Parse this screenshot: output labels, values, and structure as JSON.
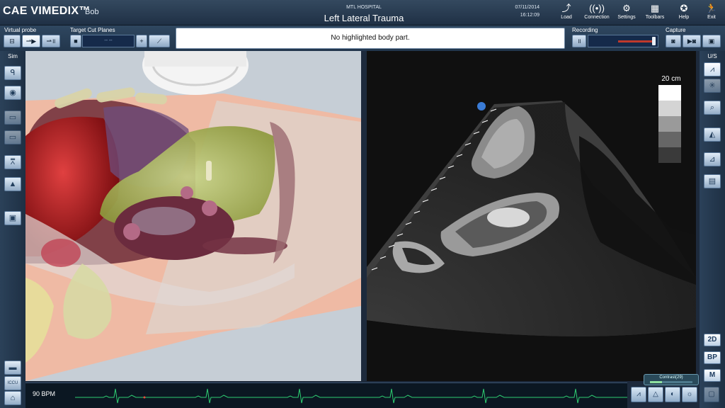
{
  "header": {
    "brand": "CAE VIMEDIX™",
    "user": "Bob",
    "hospital": "MTL HOSPITAL",
    "case_title": "Left Lateral Trauma",
    "date": "07/11/2014",
    "time": "16:12:09",
    "buttons": [
      {
        "label": "Load",
        "icon": "load-icon"
      },
      {
        "label": "Connection",
        "icon": "connection-icon"
      },
      {
        "label": "Settings",
        "icon": "gear-icon"
      },
      {
        "label": "Toolbars",
        "icon": "toolbars-icon"
      },
      {
        "label": "Help",
        "icon": "help-icon"
      },
      {
        "label": "Exit",
        "icon": "exit-icon"
      }
    ]
  },
  "toolbar": {
    "virtual_probe_label": "Virtual probe",
    "target_cut_planes_label": "Target Cut Planes",
    "message": "No highlighted body part.",
    "recording_label": "Recording",
    "capture_label": "Capture",
    "cut_plane_field": "-- --"
  },
  "left_panel": {
    "title": "Sim",
    "bottom_label": "ICCU"
  },
  "right_panel": {
    "title": "U/S",
    "mode_2d": "2D",
    "mode_bp": "BP",
    "mode_m": "M"
  },
  "ultrasound": {
    "depth_label": "20 cm"
  },
  "ecg": {
    "heart_rate": "90 BPM"
  },
  "contrast": {
    "label": "Contrast(29)",
    "level": 0.29
  },
  "colors": {
    "accent": "#8fb1d4",
    "ecg_trace": "#2ecc71"
  }
}
